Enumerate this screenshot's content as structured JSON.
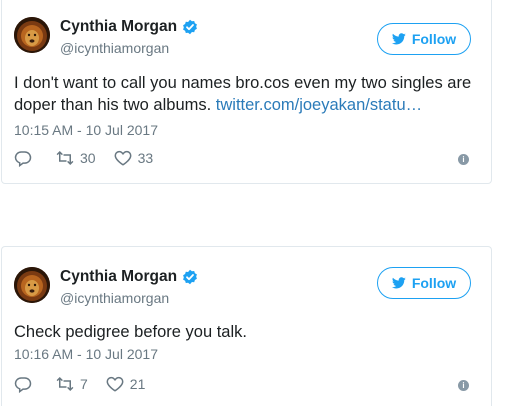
{
  "tweets": [
    {
      "author": {
        "name": "Cynthia Morgan",
        "handle": "@icynthiamorgan"
      },
      "follow_label": "Follow",
      "text": "I don't want to call you names bro.cos even my two singles are doper than his two albums. ",
      "link": "twitter.com/joeyakan/statu…",
      "timestamp": "10:15 AM - 10 Jul 2017",
      "retweets": "30",
      "likes": "33"
    },
    {
      "author": {
        "name": "Cynthia Morgan",
        "handle": "@icynthiamorgan"
      },
      "follow_label": "Follow",
      "text": "Check pedigree before you talk.",
      "timestamp": "10:16 AM - 10 Jul 2017",
      "retweets": "7",
      "likes": "21"
    }
  ],
  "colors": {
    "accent": "#1da1f2",
    "link": "#2b7bb9",
    "muted": "#697882"
  },
  "icons": [
    "lion-avatar",
    "verified-badge-icon",
    "twitter-bird-icon",
    "reply-icon",
    "retweet-icon",
    "like-heart-icon",
    "info-icon"
  ]
}
